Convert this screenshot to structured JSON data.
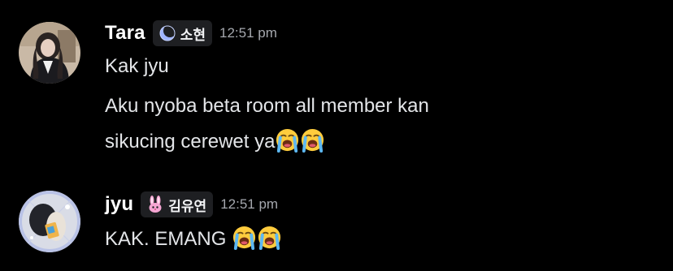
{
  "messages": [
    {
      "author": "Tara",
      "role_tag": "소현",
      "role_icon": "moon-icon",
      "timestamp": "12:51 pm",
      "lines": [
        {
          "text": "Kak jyu"
        },
        {
          "text": "Aku nyoba beta room all member kan"
        },
        {
          "text": "sikucing cerewet ya",
          "emoji": [
            "loudly-crying-face",
            "loudly-crying-face"
          ]
        }
      ]
    },
    {
      "author": "jyu",
      "role_tag": "김유연",
      "role_icon": "bunny-icon",
      "timestamp": "12:51 pm",
      "lines": [
        {
          "text": "KAK. EMANG ",
          "emoji": [
            "loudly-crying-face",
            "loudly-crying-face"
          ]
        }
      ]
    }
  ],
  "colors": {
    "background": "#000000",
    "username": "#ffffff",
    "message_text": "#e3e5e8",
    "timestamp": "#a5a8ae",
    "role_tag_bg": "#1e1f22"
  }
}
